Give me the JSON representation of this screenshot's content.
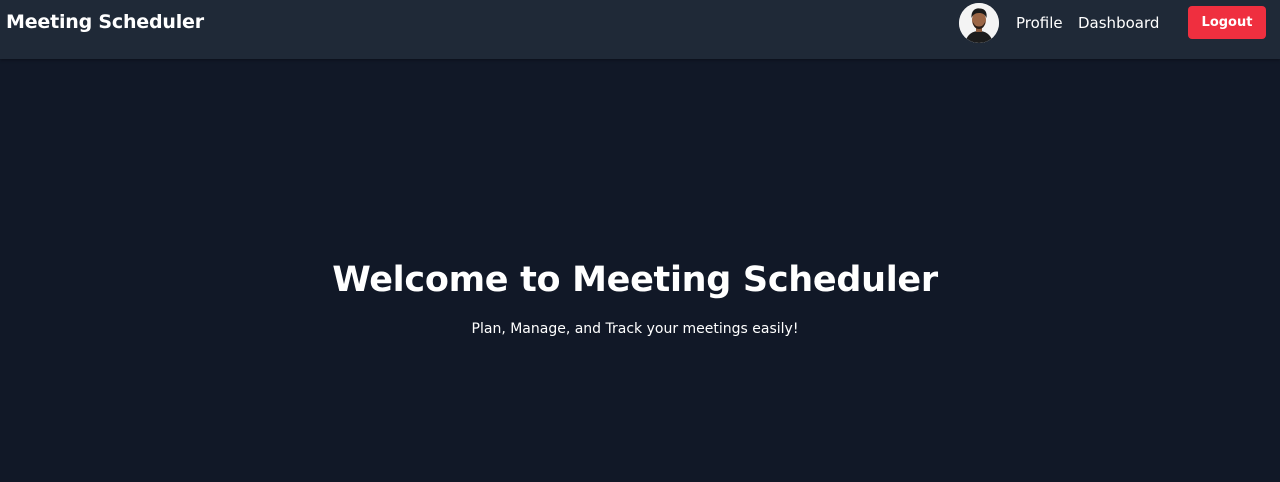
{
  "navbar": {
    "brand": "Meeting Scheduler",
    "links": {
      "profile": "Profile",
      "dashboard": "Dashboard"
    },
    "logout_label": "Logout",
    "avatar_icon": "user-avatar-icon"
  },
  "hero": {
    "title": "Welcome to Meeting Scheduler",
    "subtitle": "Plan, Manage, and Track your meetings easily!"
  },
  "colors": {
    "navbar_bg": "#1f2937",
    "page_bg": "#111827",
    "logout_bg": "#ef2f3f",
    "text": "#ffffff"
  }
}
